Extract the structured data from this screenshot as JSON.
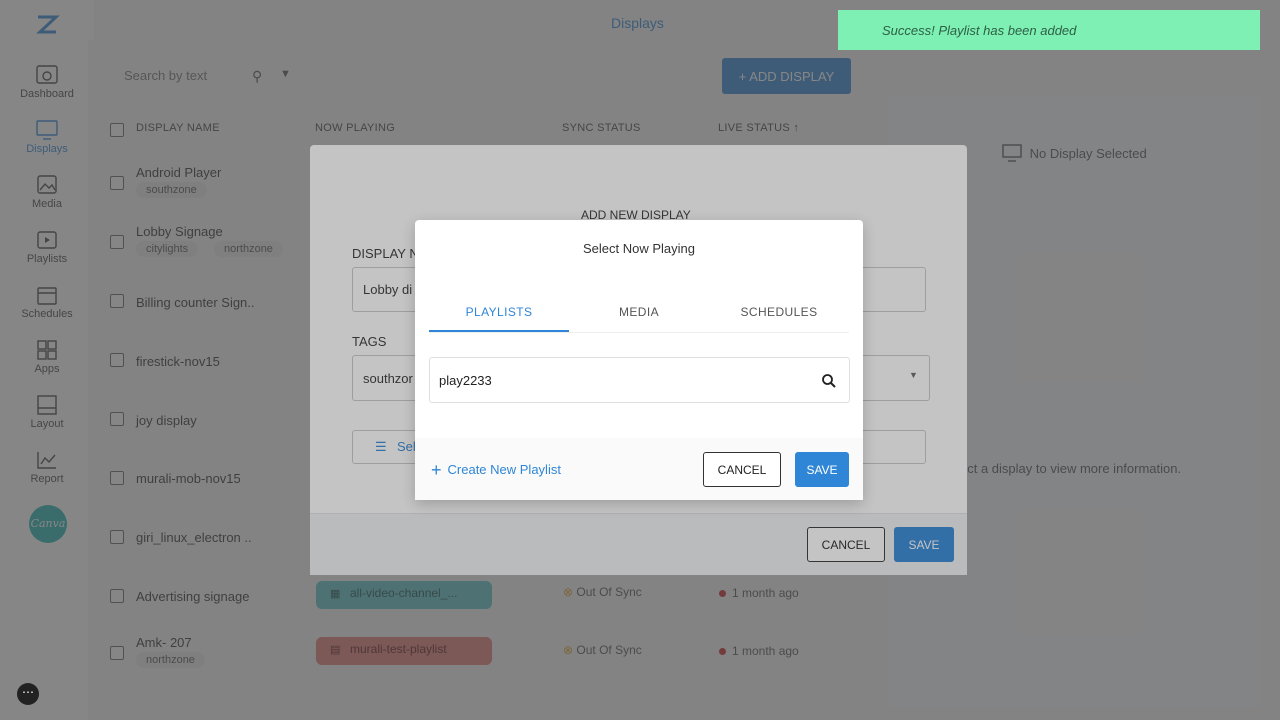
{
  "app": {
    "page_title": "Displays"
  },
  "sidebar": {
    "items": [
      {
        "label": "Dashboard",
        "icon": "dashboard-icon"
      },
      {
        "label": "Displays",
        "icon": "monitor-icon",
        "active": true
      },
      {
        "label": "Media",
        "icon": "image-icon"
      },
      {
        "label": "Playlists",
        "icon": "playlist-icon"
      },
      {
        "label": "Schedules",
        "icon": "calendar-icon"
      },
      {
        "label": "Apps",
        "icon": "apps-icon"
      },
      {
        "label": "Layout",
        "icon": "layout-icon"
      },
      {
        "label": "Report",
        "icon": "chart-icon"
      }
    ],
    "canva_label": "Canva"
  },
  "toolbar": {
    "search_placeholder": "Search by text",
    "add_display_label": "+ ADD DISPLAY"
  },
  "table": {
    "headers": [
      "DISPLAY NAME",
      "NOW PLAYING",
      "SYNC STATUS",
      "LIVE STATUS ↑"
    ],
    "rows": [
      {
        "name": "Android Player",
        "tags": [
          "southzone"
        ]
      },
      {
        "name": "Lobby Signage",
        "tags": [
          "citylights",
          "northzone"
        ]
      },
      {
        "name": "Billing counter Sign..",
        "tags": []
      },
      {
        "name": "firestick-nov15",
        "tags": []
      },
      {
        "name": "joy display",
        "tags": []
      },
      {
        "name": "murali-mob-nov15",
        "tags": []
      },
      {
        "name": "giri_linux_electron ..",
        "tags": []
      },
      {
        "name": "Advertising signage",
        "tags": [],
        "now_playing": "all-video-channel_...",
        "sync": "Out Of Sync",
        "live": "1 month ago"
      },
      {
        "name": "Amk- 207",
        "tags": [
          "northzone"
        ],
        "now_playing": "murali-test-playlist",
        "sync": "Out Of Sync",
        "live": "1 month ago"
      }
    ]
  },
  "right_panel": {
    "no_display": "No Display Selected",
    "info": "ect a display to view more information."
  },
  "add_display_dialog": {
    "title": "ADD NEW DISPLAY",
    "display_name_label": "DISPLAY N",
    "display_name_value": "Lobby di",
    "tags_label": "TAGS",
    "tags_value": "southzor",
    "select_label": "Sel",
    "cancel_label": "CANCEL",
    "save_label": "SAVE"
  },
  "now_playing_dialog": {
    "title": "Select Now Playing",
    "tabs": [
      "PLAYLISTS",
      "MEDIA",
      "SCHEDULES"
    ],
    "active_tab": "PLAYLISTS",
    "search_value": "play2233",
    "create_label": "Create New Playlist",
    "cancel_label": "CANCEL",
    "save_label": "SAVE"
  },
  "toast": {
    "message": "Success! Playlist has been added"
  },
  "colors": {
    "accent": "#2f86d6",
    "toast_bg": "#7ef0b4",
    "tag_teal": "#5ec5c8",
    "tag_red": "#e07b78"
  }
}
